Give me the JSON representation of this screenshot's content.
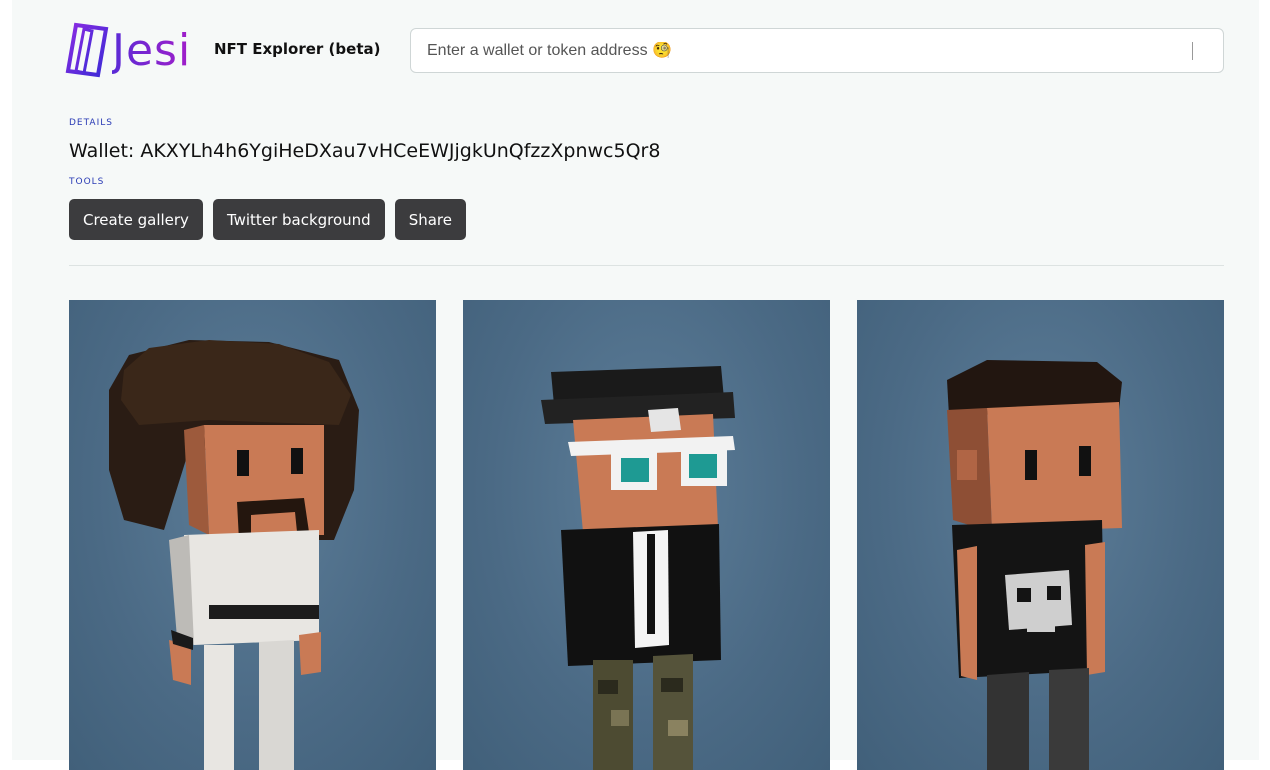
{
  "header": {
    "logo_text": "Jesi",
    "subtitle": "NFT Explorer (beta)",
    "search_placeholder": "Enter a wallet or token address 🧐"
  },
  "details": {
    "label": "DETAILS",
    "wallet_text": "Wallet: AKXYLh4h6YgiHeDXau7vHCeEWJjgkUnQfzzXpnwc5Qr8"
  },
  "tools": {
    "label": "TOOLS",
    "buttons": [
      "Create gallery",
      "Twitter background",
      "Share"
    ]
  },
  "gallery": {
    "items": [
      {
        "icon": "nft-avatar-curly-hair-white-shirt"
      },
      {
        "icon": "nft-avatar-cap-glasses-jacket"
      },
      {
        "icon": "nft-avatar-skull-tshirt"
      }
    ]
  },
  "colors": {
    "accent": "#5a2bd6",
    "button_bg": "#3c3c3e",
    "label": "#2a3bb5",
    "card_bg": "#4b6a85"
  }
}
